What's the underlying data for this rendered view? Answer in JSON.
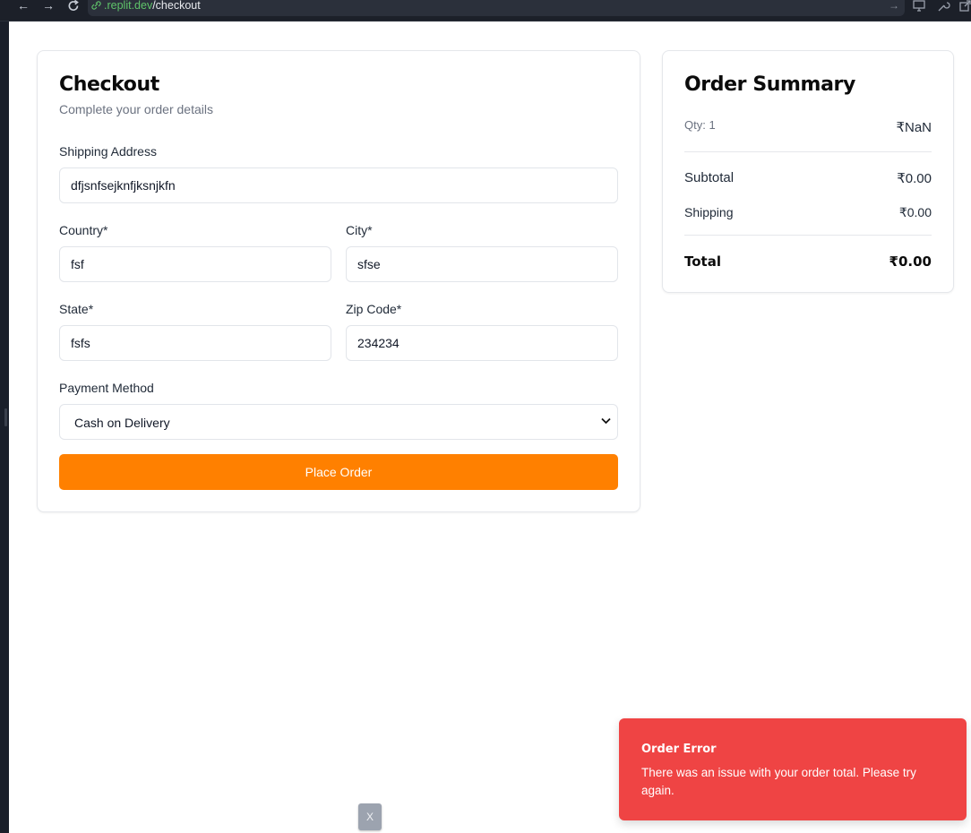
{
  "browser": {
    "url_host": ".replit.dev",
    "url_path": "/checkout"
  },
  "checkout": {
    "title": "Checkout",
    "subtitle": "Complete your order details",
    "shipping_address_label": "Shipping Address",
    "shipping_address_value": "dfjsnfsejknfjksnjkfn",
    "country_label": "Country*",
    "country_value": "fsf",
    "city_label": "City*",
    "city_value": "sfse",
    "state_label": "State*",
    "state_value": "fsfs",
    "zip_label": "Zip Code*",
    "zip_value": "234234",
    "payment_label": "Payment Method",
    "payment_value": "Cash on Delivery",
    "place_order_label": "Place Order",
    "accent_color": "#ff8000"
  },
  "summary": {
    "title": "Order Summary",
    "qty_label": "Qty: 1",
    "qty_price": "₹NaN",
    "subtotal_label": "Subtotal",
    "subtotal_value": "₹0.00",
    "shipping_label": "Shipping",
    "shipping_value": "₹0.00",
    "total_label": "Total",
    "total_value": "₹0.00"
  },
  "toast": {
    "title": "Order Error",
    "message": "There was an issue with your order total. Please try again.",
    "color": "#ef4444"
  },
  "dismiss_label": "X"
}
